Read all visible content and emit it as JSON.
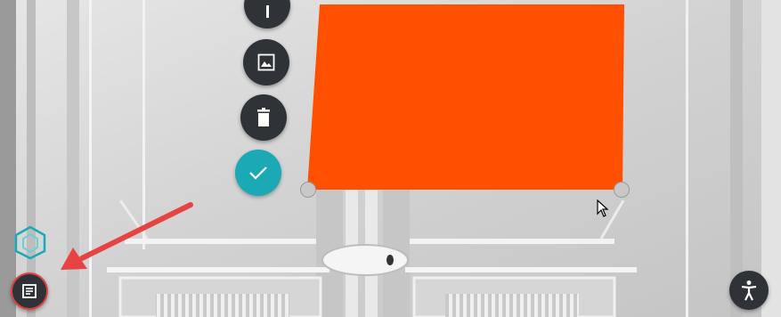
{
  "scene": {
    "background": "marble-door-panel",
    "overlay_color": "#ff4f00"
  },
  "toolbar": {
    "buttons": [
      {
        "name": "edit-button",
        "icon": "pencil-icon"
      },
      {
        "name": "image-button",
        "icon": "image-icon"
      },
      {
        "name": "delete-button",
        "icon": "trash-icon"
      },
      {
        "name": "confirm-button",
        "icon": "check-icon",
        "accent": "#1aa9b5"
      }
    ]
  },
  "bottom_left": {
    "logo_icon": "cube-logo-icon",
    "notes_button_icon": "notes-icon",
    "highlight_color": "#e04040",
    "annotation_arrow_color": "#e84343"
  },
  "bottom_right": {
    "accessibility_button_icon": "accessibility-person-icon"
  },
  "cursor": "mouse-pointer-icon"
}
